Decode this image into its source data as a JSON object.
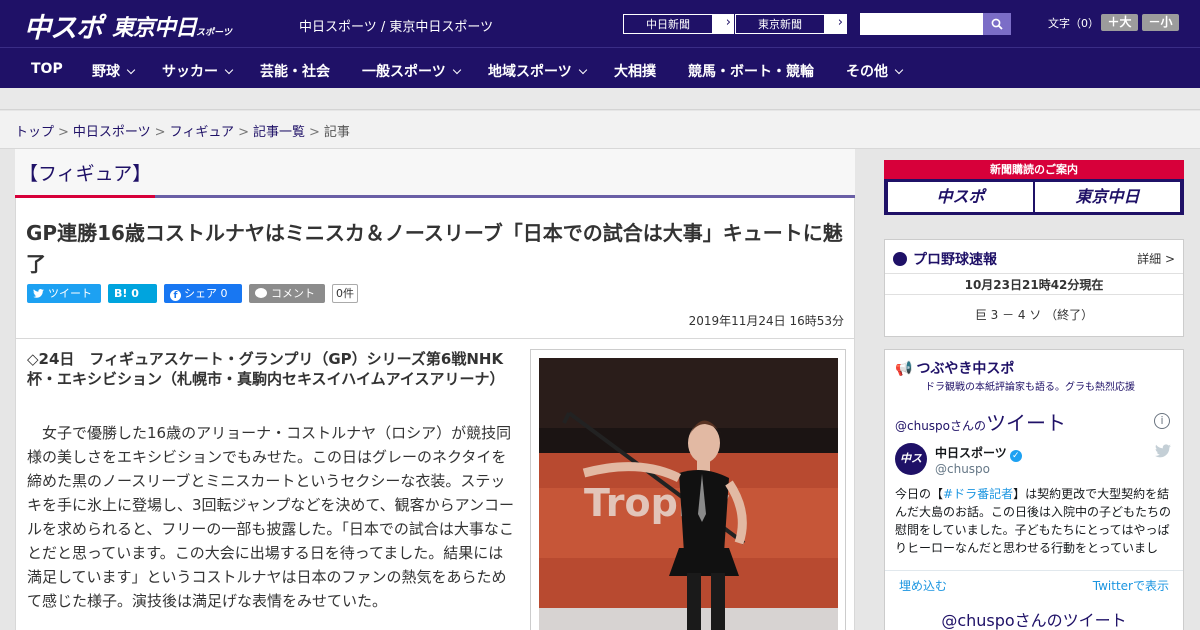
{
  "header": {
    "logo_chuspo": "中スポ",
    "logo_tokyo": "東京中日",
    "logo_tokyo_suffix": "スポーツ",
    "site_names": "中日スポーツ / 東京中日スポーツ",
    "btn_chunichi": "中日新聞",
    "btn_tokyo": "東京新聞",
    "fontsize_label": "文字（0）",
    "fs_big": "＋大",
    "fs_small": "－小"
  },
  "nav": [
    "TOP",
    "野球",
    "サッカー",
    "芸能・社会",
    "一般スポーツ",
    "地域スポーツ",
    "大相撲",
    "競馬・ボート・競輪",
    "その他"
  ],
  "breadcrumb": [
    "トップ",
    "中日スポーツ",
    "フィギュア",
    "記事一覧",
    "記事"
  ],
  "article": {
    "category": "【フィギュア】",
    "headline": "GP連勝16歳コストルナヤはミニスカ＆ノースリーブ「日本での試合は大事」キュートに魅了",
    "share_tweet": "ツイート",
    "share_hatena": "B! 0",
    "share_fb": "シェア 0",
    "share_comment": "コメント",
    "comment_count": "0件",
    "date": "2019年11月24日 16時53分",
    "lead": "◇24日　フィギュアスケート・グランプリ（GP）シリーズ第6戦NHK杯・エキシビション（札幌市・真駒内セキスイハイムアイスアリーナ）",
    "body": "　女子で優勝した16歳のアリョーナ・コストルナヤ（ロシア）が競技同様の美しさをエキシビションでもみせた。この日はグレーのネクタイを締めた黒のノースリーブとミニスカートというセクシーな衣装。ステッキを手に氷上に登場し、3回転ジャンプなどを決めて、観客からアンコールを求められると、フリーの一部も披露した。「日本での試合は大事なことだと思っています。この大会に出場する日を待ってました。結果には満足しています」というコストルナヤは日本のファンの熱気をあらためて感じた様子。演技後は満足げな表情をみせていた。",
    "photo_bg_text": "Trophy"
  },
  "sidebar": {
    "sub_top": "新聞購読のご案内",
    "sub_a": "中スポ",
    "sub_b": "東京中日",
    "bb_title": "プロ野球速報",
    "bb_detail": "詳細 >",
    "bb_time": "10月23日21時42分現在",
    "bb_score": "巨 3 － 4 ソ （終了）",
    "tsubu_title": "つぶやき中スポ",
    "tsubu_sub": "ドラ観戦の本紙評論家も語る。グラも熱烈応援",
    "tw_header_small": "@chuspoさんの",
    "tw_header_big": "ツイート",
    "tw_avatar": "中スポ",
    "tw_name": "中日スポーツ",
    "tw_handle": "@chuspo",
    "tw_text_pre": "今日の【",
    "tw_hashtag": "#ドラ番記者",
    "tw_text_post": "】は契約更改で大型契約を結んだ大島のお話。この日後は入院中の子どもたちの慰問をしていました。子どもたちにとってはやっぱりヒーローなんだと思わせる行動をとっていまし",
    "tw_embed": "埋め込む",
    "tw_view": "Twitterで表示",
    "tw_more": "@chuspoさんのツイート"
  },
  "colors": {
    "brand": "#1f1167",
    "accent_red": "#d7003a",
    "twitter": "#1da1f2"
  }
}
